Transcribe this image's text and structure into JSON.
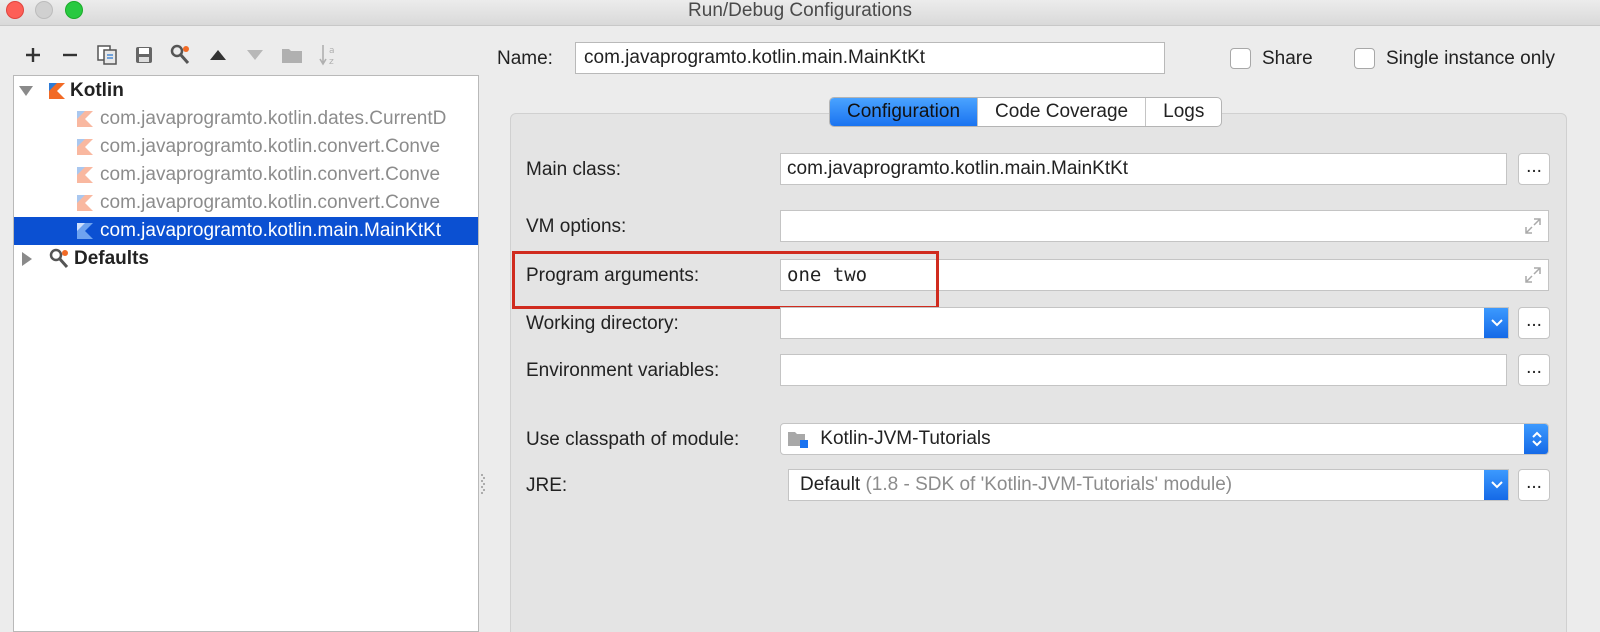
{
  "window": {
    "title": "Run/Debug Configurations"
  },
  "toolbar": {
    "buttons": [
      {
        "name": "add-button",
        "icon": "plus-icon"
      },
      {
        "name": "remove-button",
        "icon": "minus-icon"
      },
      {
        "name": "copy-button",
        "icon": "copy-icon"
      },
      {
        "name": "save-button",
        "icon": "save-icon"
      },
      {
        "name": "edit-defaults-button",
        "icon": "wrench-icon"
      },
      {
        "name": "move-up-button",
        "icon": "arrow-up-icon"
      },
      {
        "name": "move-down-button",
        "icon": "arrow-down-icon"
      },
      {
        "name": "folder-button",
        "icon": "folder-icon"
      },
      {
        "name": "sort-button",
        "icon": "sort-az-icon"
      }
    ]
  },
  "tree": {
    "kotlin": {
      "label": "Kotlin",
      "expanded": true
    },
    "items": [
      {
        "label": "com.javaprogramto.kotlin.dates.CurrentD"
      },
      {
        "label": "com.javaprogramto.kotlin.convert.Conve"
      },
      {
        "label": "com.javaprogramto.kotlin.convert.Conve"
      },
      {
        "label": "com.javaprogramto.kotlin.convert.Conve"
      },
      {
        "label": "com.javaprogramto.kotlin.main.MainKtKt"
      }
    ],
    "defaults": {
      "label": "Defaults",
      "expanded": false
    }
  },
  "header": {
    "name_label": "Name:",
    "name_value": "com.javaprogramto.kotlin.main.MainKtKt",
    "share_label": "Share",
    "single_instance_label": "Single instance only"
  },
  "tabs": [
    {
      "label": "Configuration",
      "active": true
    },
    {
      "label": "Code Coverage",
      "active": false
    },
    {
      "label": "Logs",
      "active": false
    }
  ],
  "form": {
    "main_class": {
      "label": "Main class:",
      "value": "com.javaprogramto.kotlin.main.MainKtKt"
    },
    "vm_options": {
      "label": "VM options:",
      "value": ""
    },
    "program_arguments": {
      "label": "Program arguments:",
      "value": "one two"
    },
    "working_directory": {
      "label": "Working directory:",
      "value": ""
    },
    "environment_variables": {
      "label": "Environment variables:",
      "value": ""
    },
    "classpath_module": {
      "label": "Use classpath of module:",
      "value": "Kotlin-JVM-Tutorials"
    },
    "jre": {
      "label": "JRE:",
      "value": "Default",
      "detail": "(1.8 - SDK of 'Kotlin-JVM-Tutorials' module)"
    },
    "browse_label": "..."
  },
  "colors": {
    "selection": "#0b50d2",
    "accent_blue": "#1a73f0",
    "highlight_red": "#d02b1e",
    "kotlin_orange": "#f26a25"
  }
}
